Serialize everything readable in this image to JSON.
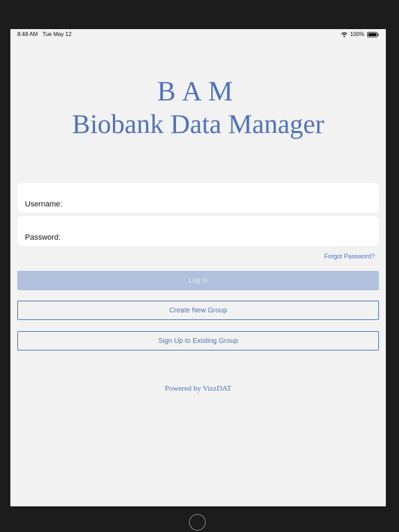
{
  "status_bar": {
    "time": "8:48 AM",
    "date": "Tue May 12",
    "battery": "100%",
    "wifi_icon": "wifi-icon",
    "battery_icon": "battery-icon"
  },
  "logo": {
    "title": "BAM",
    "subtitle": "Biobank Data Manager"
  },
  "form": {
    "username_label": "Username:",
    "username_value": "",
    "password_label": "Password:",
    "password_value": "",
    "forgot_password": "Forgot Password?"
  },
  "buttons": {
    "login": "Log In",
    "create_group": "Create New Group",
    "sign_up": "Sign Up to Existing Group"
  },
  "footer": {
    "powered_by": "Powered by VizzDAT"
  },
  "colors": {
    "accent": "#4f72b8",
    "login_disabled_bg": "#b1c1dd",
    "screen_bg": "#f2f2f2",
    "device_bezel": "#1c1c1c"
  }
}
